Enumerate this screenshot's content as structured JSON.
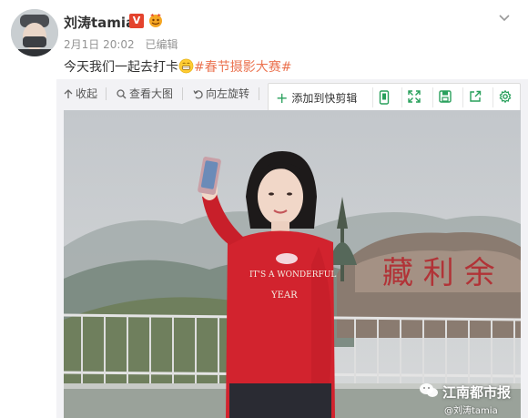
{
  "post": {
    "username": "刘涛tamia",
    "verified_mark": "V",
    "date": "2月1日 20:02",
    "edited": "已编辑",
    "text": "今天我们一起去打卡",
    "hashtag": "#春节摄影大赛#"
  },
  "toolbar": {
    "collapse": "收起",
    "view_large": "查看大图",
    "rotate_left": "向左旋转",
    "add_to_clipboard": "添加到快剪辑"
  },
  "photo": {
    "sweater_line1": "IT'S A WONDERFUL",
    "sweater_line2": "YEAR",
    "watermark": "江南都市报",
    "watermark_handle": "@刘涛tamia"
  },
  "colors": {
    "hashtag": "#eb7350",
    "verified": "#e4432d",
    "accent_green": "#29a05c",
    "sweater": "#d2232e"
  }
}
